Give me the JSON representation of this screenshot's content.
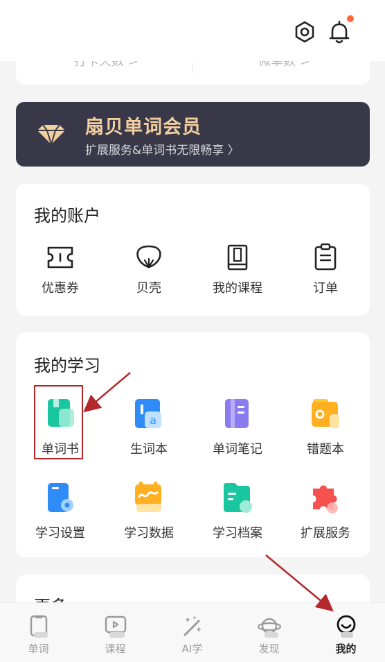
{
  "stats": {
    "left_label": "打卡天数 >",
    "right_label": "微单数 >"
  },
  "member": {
    "title": "扇贝单词会员",
    "subtitle": "扩展服务&单词书无限畅享 〉"
  },
  "account": {
    "title": "我的账户",
    "items": [
      {
        "label": "优惠券",
        "icon": "coupon-icon"
      },
      {
        "label": "贝壳",
        "icon": "shell-icon"
      },
      {
        "label": "我的课程",
        "icon": "course-book-icon"
      },
      {
        "label": "订单",
        "icon": "order-clipboard-icon"
      }
    ]
  },
  "learning": {
    "title": "我的学习",
    "items": [
      {
        "label": "单词书",
        "icon": "word-book-icon"
      },
      {
        "label": "生词本",
        "icon": "new-words-icon"
      },
      {
        "label": "单词笔记",
        "icon": "word-notes-icon"
      },
      {
        "label": "错题本",
        "icon": "mistakes-book-icon"
      },
      {
        "label": "学习设置",
        "icon": "study-settings-icon"
      },
      {
        "label": "学习数据",
        "icon": "study-data-icon"
      },
      {
        "label": "学习档案",
        "icon": "study-archive-icon"
      },
      {
        "label": "扩展服务",
        "icon": "extension-puzzle-icon"
      }
    ]
  },
  "more": {
    "title": "更多"
  },
  "tabs": [
    {
      "label": "单词",
      "icon": "word-tab-icon"
    },
    {
      "label": "课程",
      "icon": "course-tab-icon"
    },
    {
      "label": "AI学",
      "icon": "ai-magic-icon"
    },
    {
      "label": "发现",
      "icon": "planet-icon"
    },
    {
      "label": "我的",
      "icon": "smiley-icon",
      "active": true
    }
  ],
  "colors": {
    "member_bg": "#393848",
    "member_title": "#f3cfa0",
    "annotation_red": "#b2282d",
    "notification_dot": "#ff6a3d"
  }
}
